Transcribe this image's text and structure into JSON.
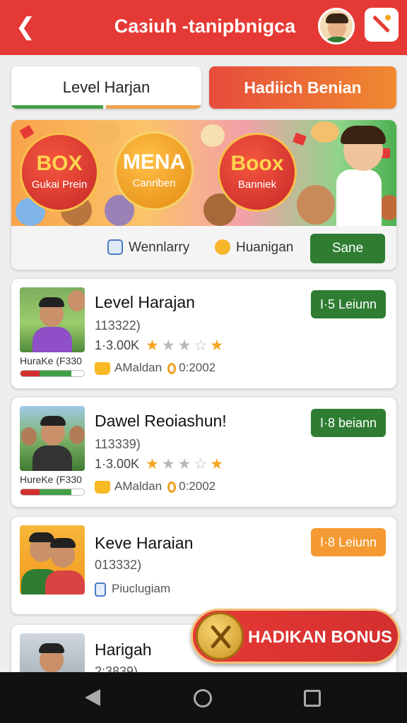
{
  "header": {
    "title": "Caɜiuh -tanipbnigca",
    "back_icon": "back-arrow-icon",
    "edit_icon": "pencil-icon"
  },
  "tabs": [
    {
      "label": "Level Harjan"
    },
    {
      "label": "Hadiich Benian"
    }
  ],
  "promo": {
    "circles": [
      {
        "big": "BOX",
        "small": "Gukai Prein"
      },
      {
        "big": "MENA",
        "small": "Canriben"
      },
      {
        "big": "Boox",
        "small": "Banniek"
      }
    ],
    "chip1": "Wennlarry",
    "chip2": "Huanigan",
    "save_label": "Sane"
  },
  "cards": [
    {
      "title": "Level Harajan",
      "code": "113322)",
      "count": "1·3.00K",
      "sub_label": "HuraKe (F330",
      "meta_name": "AMaldan",
      "meta_value": "0:2002",
      "badge": "I·5 Leiunn",
      "badge_color": "#2e7d32",
      "progress_red": 0.3,
      "progress_green": 0.5
    },
    {
      "title": "Dawel Reoiashun!",
      "code": "113339)",
      "count": "1·3.00K",
      "sub_label": "HureKe (F330",
      "meta_name": "AMaldan",
      "meta_value": "0:2002",
      "badge": "I·8 beiann",
      "badge_color": "#2e7d32",
      "progress_red": 0.3,
      "progress_green": 0.5
    },
    {
      "title": "Keve Haraian",
      "code": "013332)",
      "meta_name": "Piuclugiam",
      "badge": "I·8 Leiunn",
      "badge_color": "#f59a32"
    },
    {
      "title": "Harigah",
      "code": "2:3839)"
    }
  ],
  "bonus_label": "HADIKAN BONUS",
  "colors": {
    "primary_red": "#e53935",
    "green": "#2e7d32",
    "orange": "#f59a32"
  }
}
